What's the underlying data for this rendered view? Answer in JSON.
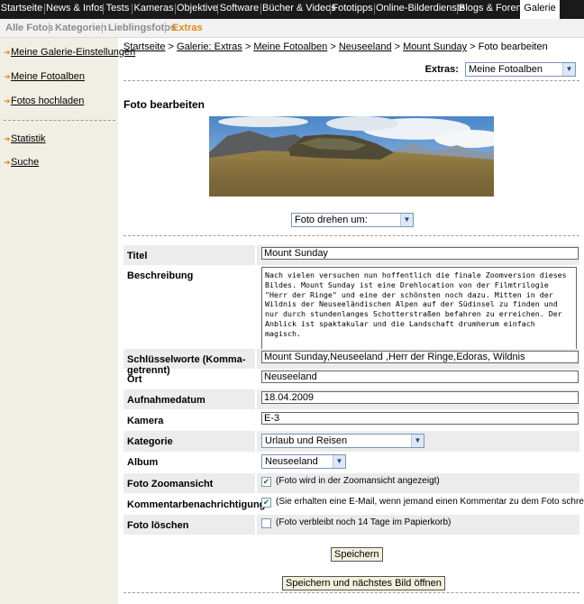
{
  "topnav": {
    "items": [
      "Startseite",
      "News & Infos",
      "Tests",
      "Kameras",
      "Objektive",
      "Software",
      "Bücher & Videos",
      "Fototipps",
      "Online-Bilderdienste",
      "Blogs & Foren",
      "Galerie"
    ]
  },
  "subnav": {
    "items": [
      "Alle Fotos",
      "Kategorien",
      "Lieblingsfotos",
      "Extras"
    ]
  },
  "sidebar": {
    "items": [
      "Meine Galerie-Einstellungen",
      "Meine Fotoalben",
      "Fotos hochladen",
      "Statistik",
      "Suche"
    ]
  },
  "breadcrumb": {
    "links": [
      "Startseite",
      "Galerie: Extras",
      "Meine Fotoalben",
      "Neuseeland",
      "Mount Sunday"
    ],
    "current": "Foto bearbeiten",
    "separator": ">"
  },
  "extras": {
    "label": "Extras:",
    "selected": "Meine Fotoalben"
  },
  "page_title": "Foto bearbeiten",
  "rotate_select": "Foto drehen um:",
  "form": {
    "title_label": "Titel",
    "title_value": "Mount Sunday",
    "desc_label": "Beschreibung",
    "desc_value": "Nach vielen versuchen nun hoffentlich die finale Zoomversion dieses Bildes. Mount Sunday ist eine Drehlocation von der Filmtrilogie \"Herr der Ringe\" und eine der schönsten noch dazu. Mitten in der Wildnis der Neuseeländischen Alpen auf der Südinsel zu finden und nur durch stundenlanges Schotterstraßen befahren zu erreichen. Der Anblick ist spaktakular und die Landschaft drumherum einfach magisch.",
    "keywords_label": "Schlüsselworte (Komma-getrennt)",
    "keywords_value": "Mount Sunday,Neuseeland ,Herr der Ringe,Edoras, Wildnis",
    "place_label": "Ort",
    "place_value": "Neuseeland",
    "date_label": "Aufnahmedatum",
    "date_value": "18.04.2009",
    "camera_label": "Kamera",
    "camera_value": "E-3",
    "category_label": "Kategorie",
    "category_value": "Urlaub und Reisen",
    "album_label": "Album",
    "album_value": "Neuseeland",
    "zoom_label": "Foto Zoomansicht",
    "zoom_text": "(Foto wird in der Zoomansicht angezeigt)",
    "notify_label": "Kommentarbenachrichtigung",
    "notify_text": "(Sie erhalten eine E-Mail, wenn jemand einen Kommentar zu dem Foto schreibt)",
    "delete_label": "Foto löschen",
    "delete_text": "(Foto verbleibt noch 14 Tage im Papierkorb)"
  },
  "checks": {
    "zoom": true,
    "notify": true,
    "delete": false
  },
  "buttons": {
    "save": "Speichern",
    "save_next": "Speichern und nächstes Bild öffnen"
  },
  "colors": {
    "topnav_bg": "#1a1a1a",
    "accent": "#e08a1a",
    "sidebar_bg": "#f1efe4",
    "row_shade": "#ececec"
  }
}
